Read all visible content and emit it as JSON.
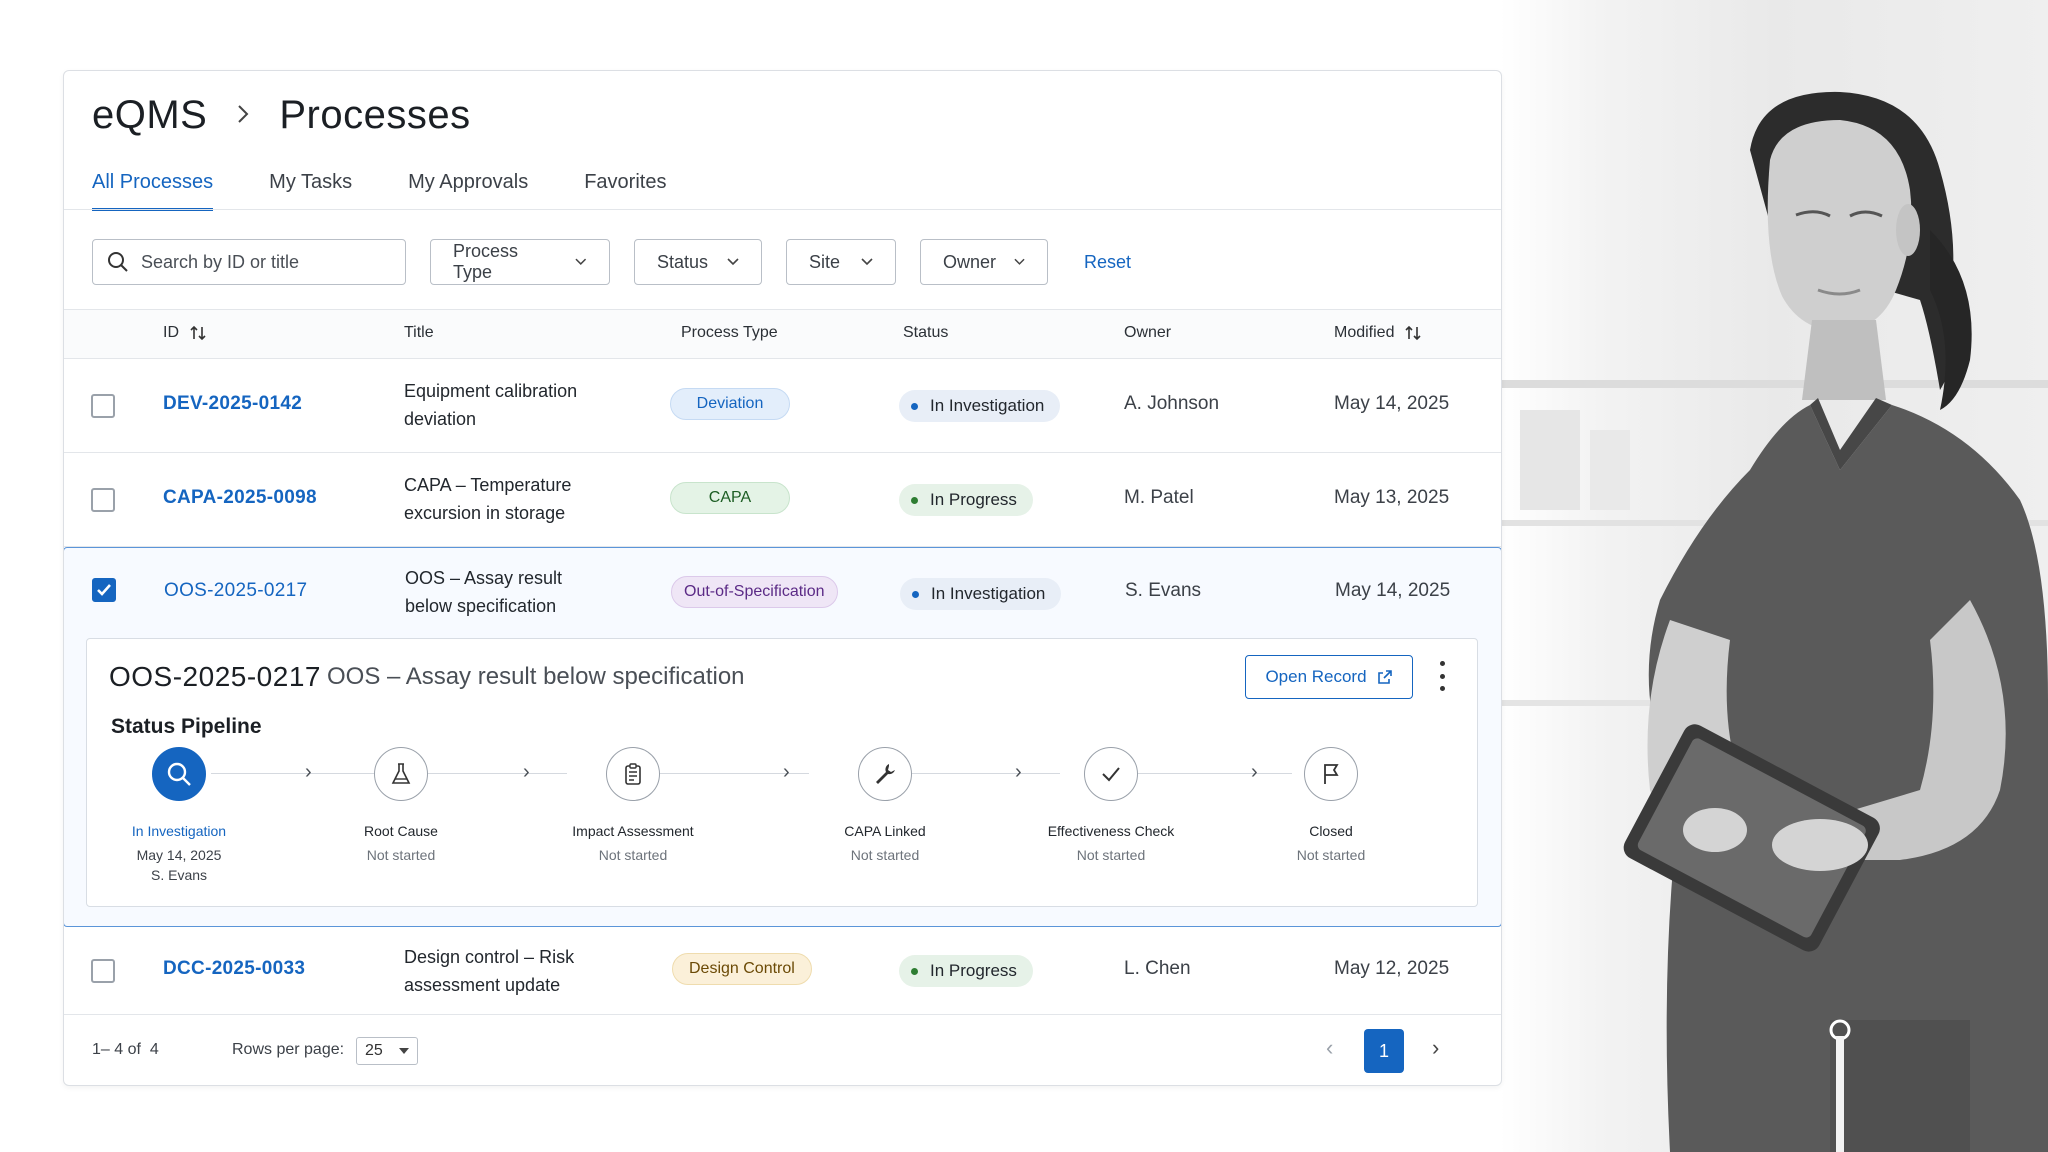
{
  "breadcrumb": {
    "root": "eQMS",
    "separator": ">",
    "current": "Processes"
  },
  "tabs": [
    {
      "label": "All Processes",
      "active": true
    },
    {
      "label": "My Tasks",
      "active": false
    },
    {
      "label": "My Approvals",
      "active": false
    },
    {
      "label": "Favorites",
      "active": false
    }
  ],
  "filters": {
    "search_placeholder": "Search by ID or title",
    "process_type": "Process Type",
    "status": "Status",
    "site": "Site",
    "owner": "Owner",
    "reset": "Reset"
  },
  "columns": {
    "id": "ID",
    "title": "Title",
    "process_type": "Process Type",
    "status": "Status",
    "owner": "Owner",
    "modified": "Modified"
  },
  "rows": [
    {
      "id": "DEV-2025-0142",
      "title1": "Equipment calibration",
      "title2": "deviation",
      "type": "Deviation",
      "status": "In Investigation",
      "owner": "A. Johnson",
      "modified": "May 14, 2025",
      "checked": false
    },
    {
      "id": "CAPA-2025-0098",
      "title1": "CAPA – Temperature",
      "title2": "excursion in storage",
      "type": "CAPA",
      "status": "In Progress",
      "owner": "M. Patel",
      "modified": "May 13, 2025",
      "checked": false
    },
    {
      "id": "OOS-2025-0217",
      "title1": "OOS – Assay result",
      "title2": "below specification",
      "type": "Out-of-Specification",
      "status": "In Investigation",
      "owner": "S. Evans",
      "modified": "May 14, 2025",
      "checked": true
    },
    {
      "id": "DCC-2025-0033",
      "title1": "Design control – Risk",
      "title2": "assessment update",
      "type": "Design Control",
      "status": "In Progress",
      "owner": "L. Chen",
      "modified": "May 12, 2025",
      "checked": false
    }
  ],
  "detail": {
    "id": "OOS-2025-0217",
    "title": "OOS – Assay result below specification",
    "open_record": "Open Record",
    "pipeline_label": "Status Pipeline",
    "stages": [
      {
        "name": "In Investigation",
        "status": "May 14, 2025",
        "extra": "S. Evans",
        "icon": "search-icon"
      },
      {
        "name": "Root Cause",
        "status": "Not started",
        "icon": "flask-icon"
      },
      {
        "name": "Impact Assessment",
        "status": "Not started",
        "icon": "clipboard-icon"
      },
      {
        "name": "CAPA Linked",
        "status": "Not started",
        "icon": "wrench-icon"
      },
      {
        "name": "Effectiveness Check",
        "status": "Not started",
        "icon": "check-icon"
      },
      {
        "name": "Closed",
        "status": "Not started",
        "icon": "flag-icon"
      }
    ]
  },
  "footer": {
    "range": "1– 4 of  4",
    "rows_per_page_label": "Rows per page:",
    "rows_per_page": "25",
    "current_page": "1"
  },
  "colors": {
    "accent": "#1565c0",
    "deviation_bg": "#e3eefb",
    "capa_bg": "#e4f3e6",
    "oos_bg": "#efe6f6",
    "design_bg": "#fbf0d9",
    "investigation_dot": "#1565c0",
    "progress_dot": "#2e7d32"
  }
}
